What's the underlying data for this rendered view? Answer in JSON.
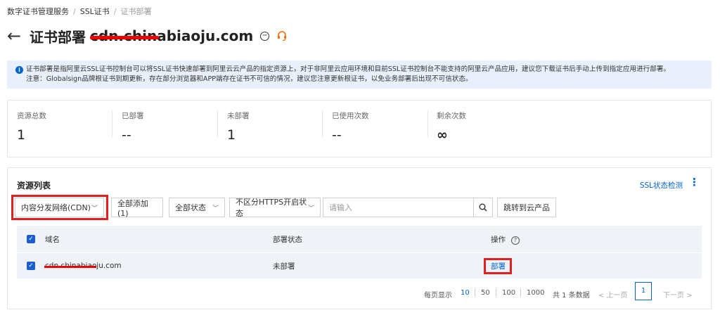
{
  "breadcrumb": {
    "items": [
      "数字证书管理服务",
      "SSL证书"
    ],
    "current": "证书部署",
    "separator": "/"
  },
  "title": {
    "back_icon": "arrow-left-icon",
    "text": "证书部署",
    "domain": "cdn.chinabiaoju.com"
  },
  "notice": {
    "line1": "证书部署是指阿里云SSL证书控制台可以将SSL证书快速部署到阿里云云产品的指定资源上，对于非阿里云应用环境和目前SSL证书控制台不能支持的阿里云产品应用，建议您下载证书后手动上传到指定应用进行部署。",
    "line2": "注意：Globalsign品牌根证书到期更新，存在部分浏览器和APP端存在证书不可信的情况，建议您注意更新根证书，以免业务部署后出现不可信状态。"
  },
  "stats": [
    {
      "label": "资源总数",
      "value": "1"
    },
    {
      "label": "已部署",
      "value": "--"
    },
    {
      "label": "未部署",
      "value": "1"
    },
    {
      "label": "已使用次数",
      "value": "--"
    },
    {
      "label": "剩余次数",
      "value": "∞"
    }
  ],
  "resources": {
    "title": "资源列表",
    "ssl_check": "SSL状态检测",
    "product_select": "内容分发网络(CDN)",
    "add_all": "全部添加(1)",
    "status_filter": "全部状态",
    "https_filter": "不区分HTTPS开启状态",
    "search_placeholder": "请输入",
    "jump_button": "跳转到云产品",
    "columns": {
      "domain": "域名",
      "status": "部署状态",
      "action": "操作"
    },
    "rows": [
      {
        "domain": "cdn.chinabiaoju.com",
        "status": "未部署",
        "action": "部署"
      }
    ]
  },
  "pagination": {
    "per_page_label": "每页显示",
    "sizes": [
      "10",
      "50",
      "100",
      "1000"
    ],
    "active_size": "10",
    "total": "共 1 条数据",
    "prev": "上一页",
    "current_page": "1",
    "next": "下一页"
  },
  "colors": {
    "accent": "#0064c8",
    "highlight_box": "#e41f1f",
    "notice_bg": "#eaf0fb",
    "table_bg": "#eff3f8"
  }
}
